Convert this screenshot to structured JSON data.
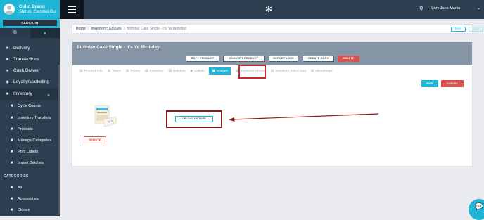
{
  "user": {
    "name": "Colin Brann",
    "status": "Status: Clocked Out",
    "clock_in_label": "CLOCK IN"
  },
  "sidebar": {
    "tab_icons": [
      "copy-icon",
      "user-icon"
    ],
    "items": [
      {
        "label": "Delivery",
        "icon": "truck-icon"
      },
      {
        "label": "Transactions",
        "icon": "cart-icon"
      },
      {
        "label": "Cash Drawer",
        "icon": "money-icon"
      },
      {
        "label": "Loyalty/Marketing",
        "icon": "bullhorn-icon"
      },
      {
        "label": "Inventory",
        "icon": "box-icon"
      }
    ],
    "sub_items": [
      {
        "label": "Cycle Counts"
      },
      {
        "label": "Inventory Transfers"
      },
      {
        "label": "Products"
      },
      {
        "label": "Manage Categories"
      },
      {
        "label": "Print Labels"
      },
      {
        "label": "Import Batches"
      }
    ],
    "categories_heading": "CATEGORIES",
    "categories": [
      {
        "label": "All"
      },
      {
        "label": "Accessories"
      },
      {
        "label": "Clones"
      }
    ]
  },
  "topbar": {
    "user_name": "Mary Jane Mania"
  },
  "breadcrumb": {
    "home": "Home",
    "section": "Inventory: Edibles",
    "current": "Birthday Cake Single - It's Yo Birthday!",
    "prev_label": "PREV",
    "next_label": "NEXT"
  },
  "product": {
    "title": "Birthday Cake Single - It's Yo Birthday!",
    "actions": {
      "copy": "COPY PRODUCT",
      "convert": "CONVERT PRODUCT",
      "report_loss": "REPORT LOSS",
      "create_copy": "CREATE COPY",
      "delete": "DELETE"
    },
    "tabs": [
      {
        "label": "Product Info",
        "icon": "info-icon"
      },
      {
        "label": "Taxes",
        "icon": "tax-icon"
      },
      {
        "label": "Prices",
        "icon": "price-icon"
      },
      {
        "label": "Inventory",
        "icon": "inventory-icon"
      },
      {
        "label": "Batches",
        "icon": "batches-icon"
      },
      {
        "label": "Labels",
        "icon": "tag-icon"
      },
      {
        "label": "Images",
        "icon": "image-icon"
      },
      {
        "label": "Inventory History",
        "icon": "history-icon"
      },
      {
        "label": "Inventory Action Log",
        "icon": "log-icon"
      },
      {
        "label": "Weedmaps",
        "icon": "weedmaps-icon"
      }
    ],
    "active_tab": "Images",
    "save_label": "SAVE",
    "cancel_label": "CANCEL",
    "remove_label": "REMOVE",
    "upload_label": "UPLOAD PICTURE"
  },
  "colors": {
    "accent": "#1eb6d4",
    "sidebar": "#2d3e50",
    "danger": "#d9534f",
    "annotation": "#c62828"
  }
}
